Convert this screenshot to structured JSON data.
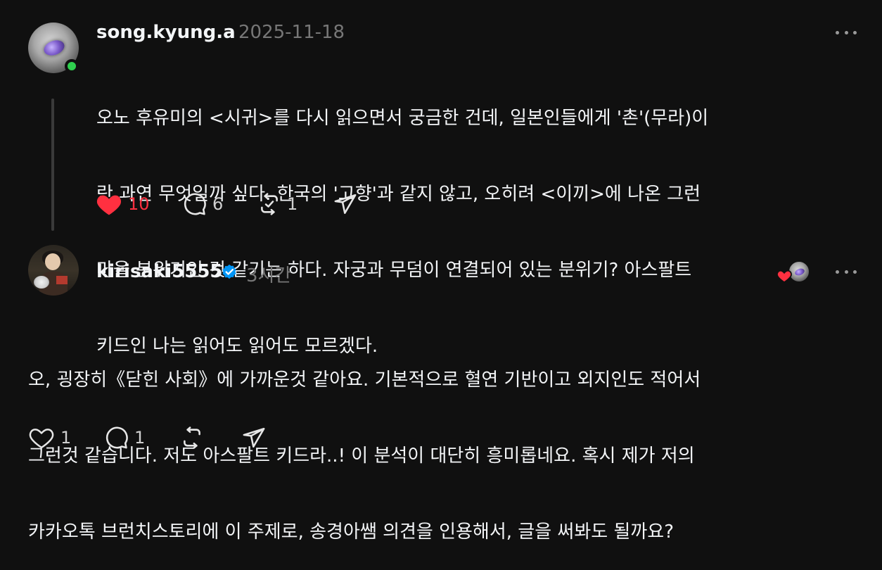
{
  "post1": {
    "username": "song.kyung.a",
    "timestamp": "2025-11-18",
    "text_lines": [
      "오노 후유미의 <시귀>를 다시 읽으면서 궁금한 건데, 일본인들에게 '촌'(무라)이",
      "란 과연 무엇일까 싶다. 한국의 '고향'과 같지 않고, 오히려 <이끼>에 나온 그런",
      "마을 분위기인 것 같기는 하다. 자궁과 무덤이 연결되어 있는 분위기? 아스팔트",
      "키드인 나는 읽어도 읽어도 모르겠다."
    ],
    "likes": "10",
    "comments": "6",
    "reposts": "1",
    "liked": true,
    "like_color": "#ff3040"
  },
  "post2": {
    "username": "kirisaki5555",
    "timestamp": "3시간",
    "verified": true,
    "verified_color": "#0095f6",
    "text_lines": [
      "오, 굉장히《닫힌 사회》에 가까운것 같아요. 기본적으로 혈연 기반이고 외지인도 적어서",
      "그런것 같습니다. 저도 아스팔트 키드라..! 이 분석이 대단히 흥미롭네요. 혹시 제가 저의",
      "카카오톡 브런치스토리에 이 주제로, 송경아쌤 의견을 인용해서, 글을 써봐도 될까요?"
    ],
    "likes": "1",
    "comments": "1"
  },
  "icons": {
    "like": "heart-icon",
    "comment": "comment-bubble-icon",
    "repost": "repost-icon",
    "share": "send-icon",
    "more": "more-horizontal-icon",
    "verified": "verified-badge-icon"
  },
  "theme": {
    "background": "#101010",
    "text": "#f3f5f7",
    "muted": "#777777",
    "online": "#2fcf4e"
  }
}
